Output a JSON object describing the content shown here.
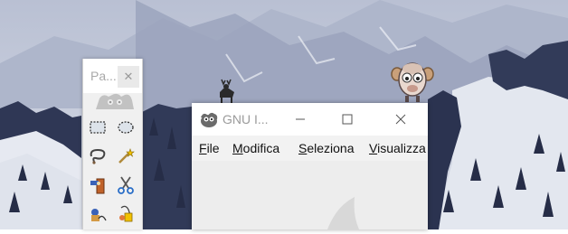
{
  "toolbox": {
    "title": "Pa...",
    "close_glyph": "✕",
    "tools": [
      {
        "name": "rect-select-tool-icon"
      },
      {
        "name": "ellipse-select-tool-icon"
      },
      {
        "name": "lasso-select-tool-icon"
      },
      {
        "name": "fuzzy-select-tool-icon"
      },
      {
        "name": "foreground-select-tool-icon"
      },
      {
        "name": "scissors-select-tool-icon"
      },
      {
        "name": "paths-tool-icon"
      },
      {
        "name": "color-picker-tool-icon"
      }
    ]
  },
  "gimp_window": {
    "title": "GNU I...",
    "menu": {
      "file": {
        "mnemonic": "F",
        "rest": "ile"
      },
      "edit": {
        "mnemonic": "M",
        "rest": "odifica"
      },
      "select": {
        "mnemonic": "S",
        "rest": "eleziona"
      },
      "view": {
        "mnemonic": "V",
        "rest": "isualizza"
      }
    }
  },
  "colors": {
    "sky": "#c9cfdd",
    "snow": "#e4e8f0",
    "forest": "#2c3350",
    "window_bg": "#f2f2f2"
  }
}
